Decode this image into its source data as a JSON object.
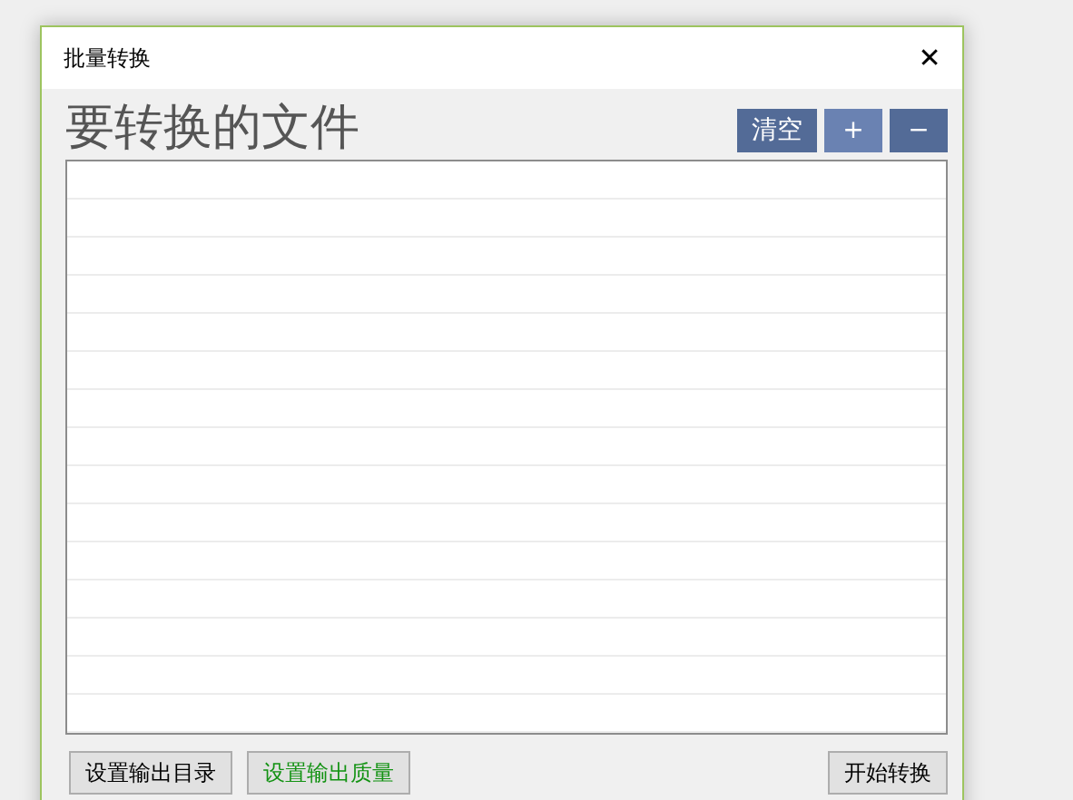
{
  "window": {
    "title": "批量转换",
    "close": "✕"
  },
  "heading": "要转换的文件",
  "toolbar": [
    {
      "label": "清空",
      "hovered": false
    },
    {
      "label": "+",
      "hovered": true
    },
    {
      "label": "−",
      "hovered": false
    }
  ],
  "footer": {
    "left": [
      {
        "label": "设置输出目录",
        "highlighted": false
      },
      {
        "label": "设置输出质量",
        "highlighted": true
      }
    ],
    "right": [
      {
        "label": "开始转换",
        "highlighted": false
      }
    ]
  }
}
